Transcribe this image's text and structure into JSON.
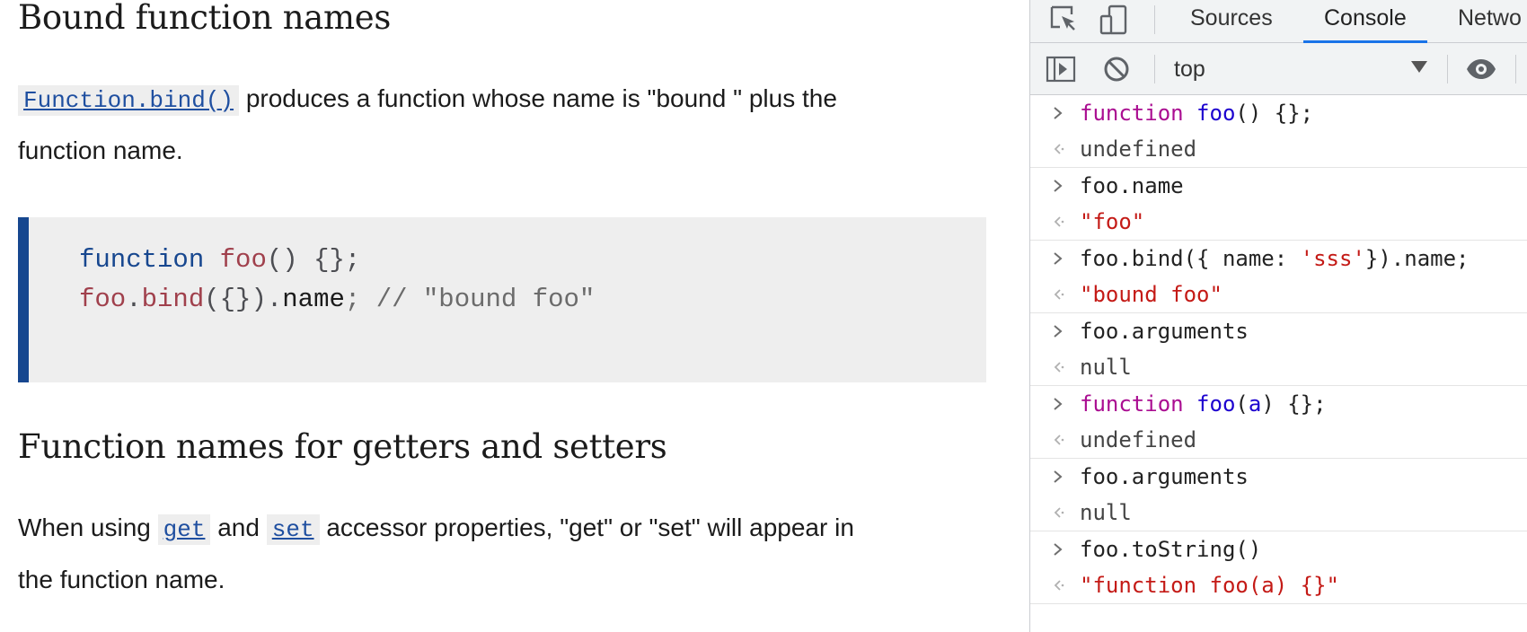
{
  "article": {
    "heading1": "Bound function names",
    "para1": {
      "code_link": "Function.bind()",
      "text_line1": " produces a function whose name is \"bound \" plus the",
      "text_line2": "function name."
    },
    "codeblock": {
      "l1_kw": "function",
      "l1_fn": "foo",
      "l1_rest": "() {};",
      "l2_obj": "foo",
      "l2_dot": ".",
      "l2_fn": "bind",
      "l2_args": "({}).",
      "l2_prop": "name",
      "l2_comment": "; // \"bound foo\""
    },
    "heading2": "Function names for getters and setters",
    "para2": {
      "t1": "When using ",
      "code1": "get",
      "t2": " and ",
      "code2": "set",
      "t3": " accessor properties, \"get\" or \"set\" will appear in",
      "line2": "the function name."
    }
  },
  "devtools": {
    "tabs": [
      "Sources",
      "Console",
      "Netwo"
    ],
    "active_tab": "Console",
    "context": "top",
    "accent_color": "#1a73e8",
    "console": [
      {
        "input": {
          "kw": "function",
          "fn": "foo",
          "rest": "() {};"
        },
        "output": "undefined",
        "output_type": "plain"
      },
      {
        "input": {
          "text": "foo.name"
        },
        "output": "\"foo\"",
        "output_type": "string"
      },
      {
        "input": {
          "pre": "foo.bind({ name: ",
          "str": "'sss'",
          "post": "}).name;"
        },
        "output": "\"bound foo\"",
        "output_type": "string"
      },
      {
        "input": {
          "text": "foo.arguments"
        },
        "output": "null",
        "output_type": "plain"
      },
      {
        "input": {
          "kw": "function",
          "fn": "foo",
          "p1": "(",
          "param": "a",
          "rest": ") {};"
        },
        "output": "undefined",
        "output_type": "plain"
      },
      {
        "input": {
          "text": "foo.arguments"
        },
        "output": "null",
        "output_type": "plain"
      },
      {
        "input": {
          "text": "foo.toString()"
        },
        "output": "\"function foo(a) {}\"",
        "output_type": "string"
      }
    ]
  }
}
